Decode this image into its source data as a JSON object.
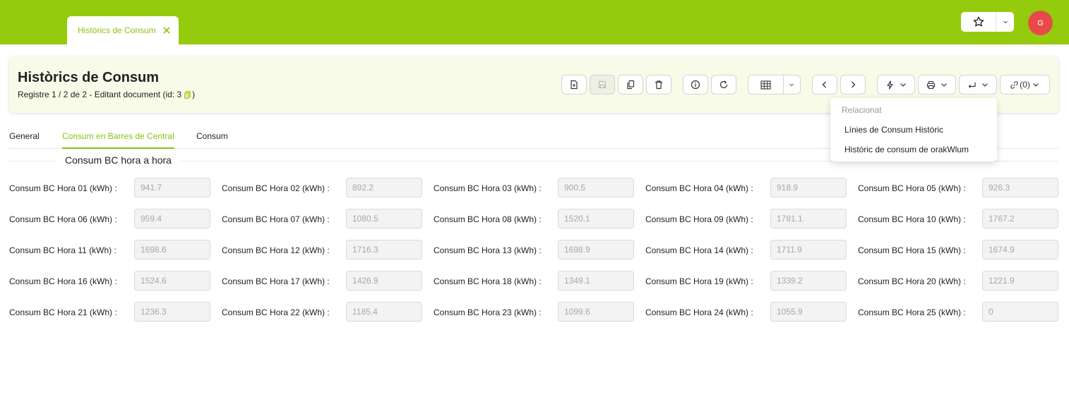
{
  "window_tab": {
    "label": "Històrics de Consum"
  },
  "user": {
    "initial": "G"
  },
  "header": {
    "title": "Històrics de Consum",
    "record_info": "Registre 1 / 2 de 2 - Editant document (id: 3",
    "record_info_end": ")"
  },
  "toolbar": {
    "links_label": "(0)"
  },
  "dropdown": {
    "heading": "Relacionat",
    "items": [
      "Línies de Consum Històric",
      "Històric de consum de orakWlum"
    ]
  },
  "tabs": [
    "General",
    "Consum en Barres de Central",
    "Consum"
  ],
  "active_tab": 1,
  "section": {
    "title": "Consum BC hora a hora"
  },
  "fields": [
    {
      "label": "Consum BC Hora 01 (kWh) :",
      "value": "941.7"
    },
    {
      "label": "Consum BC Hora 02 (kWh) :",
      "value": "892.2"
    },
    {
      "label": "Consum BC Hora 03 (kWh) :",
      "value": "900.5"
    },
    {
      "label": "Consum BC Hora 04 (kWh) :",
      "value": "918.9"
    },
    {
      "label": "Consum BC Hora 05 (kWh) :",
      "value": "926.3"
    },
    {
      "label": "Consum BC Hora 06 (kWh) :",
      "value": "959.4"
    },
    {
      "label": "Consum BC Hora 07 (kWh) :",
      "value": "1080.5"
    },
    {
      "label": "Consum BC Hora 08 (kWh) :",
      "value": "1520.1"
    },
    {
      "label": "Consum BC Hora 09 (kWh) :",
      "value": "1781.1"
    },
    {
      "label": "Consum BC Hora 10 (kWh) :",
      "value": "1767.2"
    },
    {
      "label": "Consum BC Hora 11 (kWh) :",
      "value": "1698.6"
    },
    {
      "label": "Consum BC Hora 12 (kWh) :",
      "value": "1716.3"
    },
    {
      "label": "Consum BC Hora 13 (kWh) :",
      "value": "1698.9"
    },
    {
      "label": "Consum BC Hora 14 (kWh) :",
      "value": "1711.9"
    },
    {
      "label": "Consum BC Hora 15 (kWh) :",
      "value": "1674.9"
    },
    {
      "label": "Consum BC Hora 16 (kWh) :",
      "value": "1524.6"
    },
    {
      "label": "Consum BC Hora 17 (kWh) :",
      "value": "1426.9"
    },
    {
      "label": "Consum BC Hora 18 (kWh) :",
      "value": "1349.1"
    },
    {
      "label": "Consum BC Hora 19 (kWh) :",
      "value": "1339.2"
    },
    {
      "label": "Consum BC Hora 20 (kWh) :",
      "value": "1221.9"
    },
    {
      "label": "Consum BC Hora 21 (kWh) :",
      "value": "1236.3"
    },
    {
      "label": "Consum BC Hora 22 (kWh) :",
      "value": "1185.4"
    },
    {
      "label": "Consum BC Hora 23 (kWh) :",
      "value": "1099.6"
    },
    {
      "label": "Consum BC Hora 24 (kWh) :",
      "value": "1055.9"
    },
    {
      "label": "Consum BC Hora 25 (kWh) :",
      "value": "0"
    }
  ],
  "colors": {
    "brand": "#94cb0c",
    "accent": "#8cc20e",
    "avatar": "#e84a4a"
  }
}
